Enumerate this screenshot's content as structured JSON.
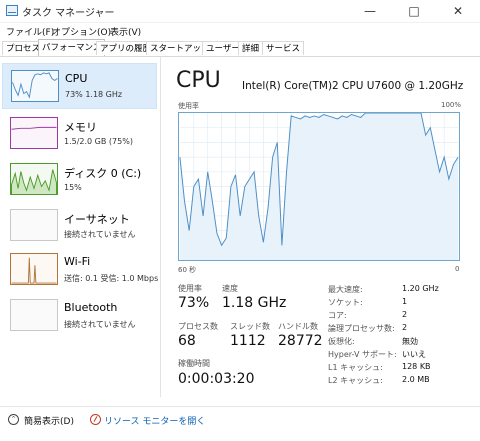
{
  "window": {
    "title": "タスク マネージャー"
  },
  "menu": [
    "ファイル(F)",
    "オプション(O)",
    "表示(V)"
  ],
  "tabs": [
    "プロセス",
    "パフォーマンス",
    "アプリの履歴",
    "スタートアップ",
    "ユーザー",
    "詳細",
    "サービス"
  ],
  "active_tab": "パフォーマンス",
  "sidebar": {
    "items": [
      {
        "title": "CPU",
        "sub": "73%  1.18 GHz",
        "color": "#4d8fc7",
        "selected": true
      },
      {
        "title": "メモリ",
        "sub": "1.5/2.0 GB (75%)",
        "color": "#9b3aa0"
      },
      {
        "title": "ディスク 0 (C:)",
        "sub": "15%",
        "color": "#4c9a2a"
      },
      {
        "title": "イーサネット",
        "sub": "接続されていません",
        "color": "#b5b5b5"
      },
      {
        "title": "Wi-Fi",
        "sub": "送信: 0.1  受信: 1.0 Mbps",
        "color": "#b0753a"
      },
      {
        "title": "Bluetooth",
        "sub": "接続されていません",
        "color": "#b5b5b5"
      }
    ]
  },
  "cpu": {
    "title": "CPU",
    "processor": "Intel(R) Core(TM)2 CPU U7600 @ 1.20GHz",
    "usage_label": "使用率",
    "max_label": "100%",
    "time_left": "60 秒",
    "time_right": "0"
  },
  "chart_data": {
    "type": "area",
    "ylim": [
      0,
      100
    ],
    "xlim": [
      60,
      0
    ],
    "series": [
      {
        "values": [
          70,
          40,
          20,
          50,
          55,
          30,
          60,
          40,
          18,
          10,
          15,
          50,
          58,
          30,
          50,
          55,
          60,
          30,
          12,
          35,
          70,
          80,
          10,
          60,
          98,
          97,
          96,
          98,
          97,
          98,
          97,
          99,
          98,
          97,
          96,
          98,
          97,
          99,
          98,
          97,
          100,
          100,
          100,
          100,
          100,
          100,
          100,
          100,
          100,
          100,
          100,
          100,
          100,
          85,
          90,
          75,
          60,
          70,
          55,
          65,
          70
        ]
      }
    ]
  },
  "stats": {
    "usage_label": "使用率",
    "usage": "73%",
    "speed_label": "速度",
    "speed": "1.18 GHz",
    "processes_label": "プロセス数",
    "processes": "68",
    "threads_label": "スレッド数",
    "threads": "1112",
    "handles_label": "ハンドル数",
    "handles": "28772",
    "uptime_label": "稼働時間",
    "uptime": "0:00:03:20"
  },
  "specs": [
    {
      "k": "最大速度:",
      "v": "1.20 GHz"
    },
    {
      "k": "ソケット:",
      "v": "1"
    },
    {
      "k": "コア:",
      "v": "2"
    },
    {
      "k": "論理プロセッサ数:",
      "v": "2"
    },
    {
      "k": "仮想化:",
      "v": "無効"
    },
    {
      "k": "Hyper-V サポート:",
      "v": "いいえ"
    },
    {
      "k": "L1 キャッシュ:",
      "v": "128 KB"
    },
    {
      "k": "L2 キャッシュ:",
      "v": "2.0 MB"
    }
  ],
  "footer": {
    "less": "簡易表示(D)",
    "monitor": "リソース モニターを開く"
  }
}
